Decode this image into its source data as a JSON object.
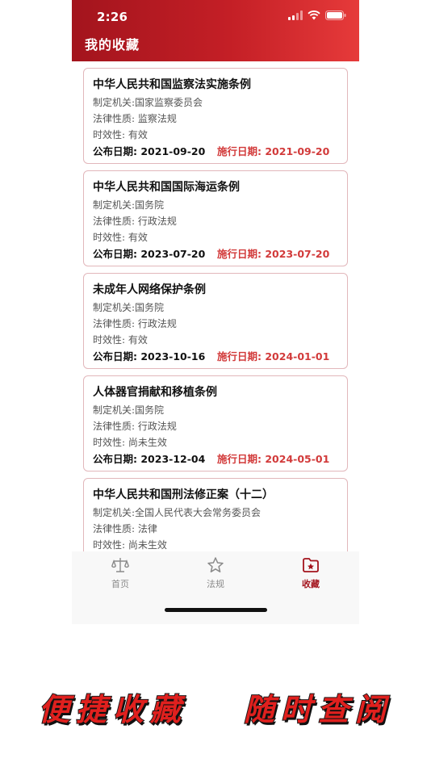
{
  "status_bar": {
    "time": "2:26"
  },
  "header": {
    "title": "我的收藏"
  },
  "cards": [
    {
      "title": "中华人民共和国监察法实施条例",
      "agency": "制定机关:国家监察委员会",
      "nature": "法律性质: 监察法规",
      "validity": "时效性: 有效",
      "published": "公布日期: 2021-09-20",
      "effective": "施行日期: 2021-09-20"
    },
    {
      "title": "中华人民共和国国际海运条例",
      "agency": "制定机关:国务院",
      "nature": "法律性质: 行政法规",
      "validity": "时效性: 有效",
      "published": "公布日期: 2023-07-20",
      "effective": "施行日期: 2023-07-20"
    },
    {
      "title": "未成年人网络保护条例",
      "agency": "制定机关:国务院",
      "nature": "法律性质: 行政法规",
      "validity": "时效性: 有效",
      "published": "公布日期: 2023-10-16",
      "effective": "施行日期: 2024-01-01"
    },
    {
      "title": "人体器官捐献和移植条例",
      "agency": "制定机关:国务院",
      "nature": "法律性质: 行政法规",
      "validity": "时效性: 尚未生效",
      "published": "公布日期: 2023-12-04",
      "effective": "施行日期: 2024-05-01"
    },
    {
      "title": "中华人民共和国刑法修正案（十二）",
      "agency": "制定机关:全国人民代表大会常务委员会",
      "nature": "法律性质: 法律",
      "validity": "时效性: 尚未生效",
      "published": "",
      "effective": ""
    }
  ],
  "tabbar": {
    "home": {
      "label": "首页",
      "icon": "scale-icon"
    },
    "laws": {
      "label": "法规",
      "icon": "star-icon"
    },
    "favorites": {
      "label": "收藏",
      "icon": "folder-star-icon"
    }
  },
  "slogan": {
    "left": "便捷收藏",
    "right": "随时查阅"
  },
  "colors": {
    "header_start": "#a3141d",
    "header_end": "#e63a3a",
    "accent": "#a3141d",
    "effective_date": "#d23a3a",
    "tab_inactive": "#8a8a8a"
  }
}
